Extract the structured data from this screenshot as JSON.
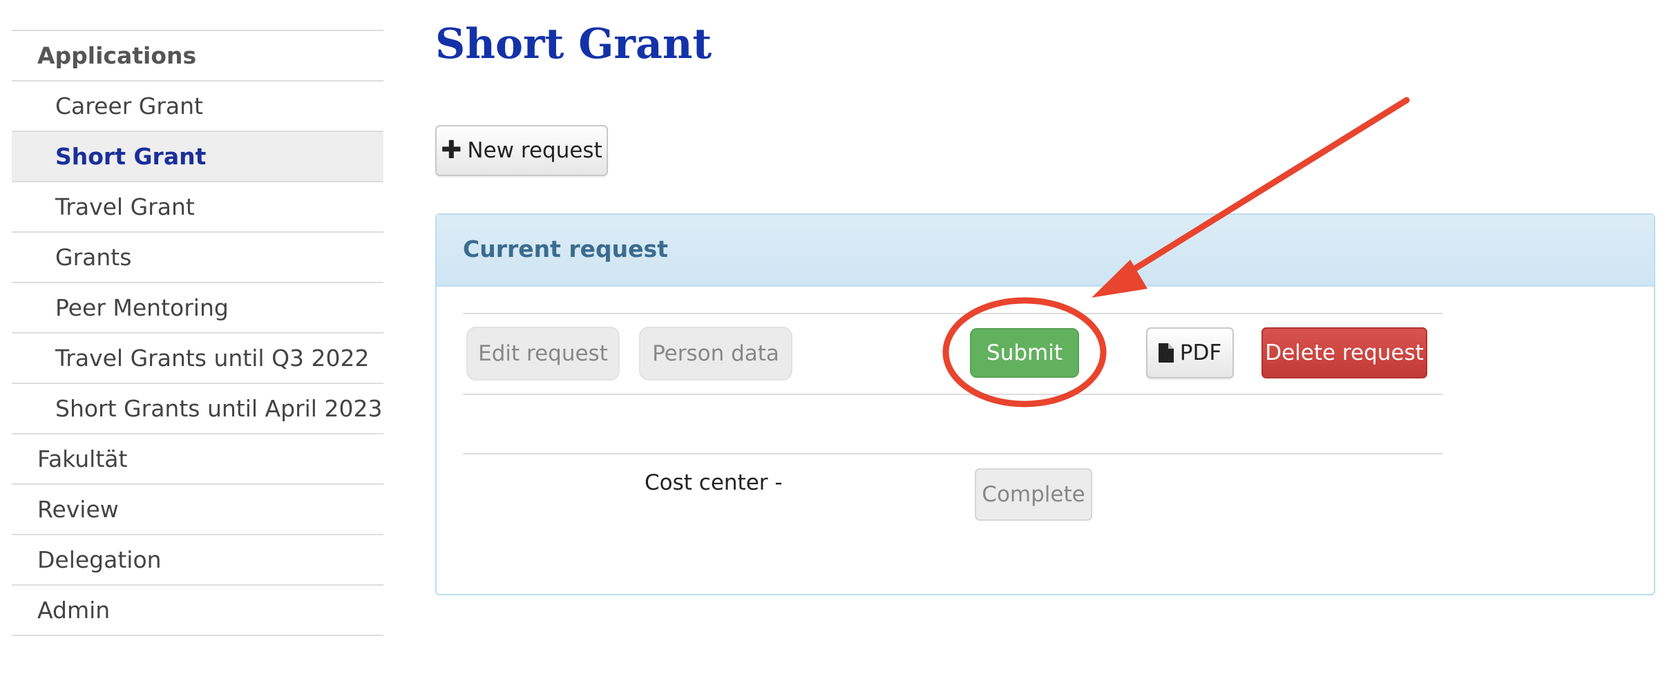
{
  "sidebar": {
    "heading": "Applications",
    "sub_items": [
      {
        "label": "Career Grant"
      },
      {
        "label": "Short Grant",
        "active": true
      },
      {
        "label": "Travel Grant"
      },
      {
        "label": "Grants"
      },
      {
        "label": "Peer Mentoring"
      },
      {
        "label": "Travel Grants until Q3 2022"
      },
      {
        "label": "Short Grants until April 2023"
      }
    ],
    "top_items": [
      {
        "label": "Fakultät"
      },
      {
        "label": "Review"
      },
      {
        "label": "Delegation"
      },
      {
        "label": "Admin"
      }
    ]
  },
  "main": {
    "title": "Short Grant",
    "new_request_label": "New request",
    "panel": {
      "title": "Current request",
      "buttons": {
        "edit_request": "Edit request",
        "person_data": "Person data",
        "submit": "Submit",
        "pdf": "PDF",
        "delete_request": "Delete request"
      },
      "cost_center_label": "Cost center -",
      "complete_label": "Complete"
    }
  },
  "annotation": {
    "type": "red-arrow-and-circle",
    "target": "submit-button",
    "color": "#e8442e"
  },
  "colors": {
    "title": "#1432a8",
    "active_nav": "#1a2f9a",
    "submit": "#62b15f",
    "delete": "#d9534f",
    "panel_heading": "#d9eaf6"
  }
}
